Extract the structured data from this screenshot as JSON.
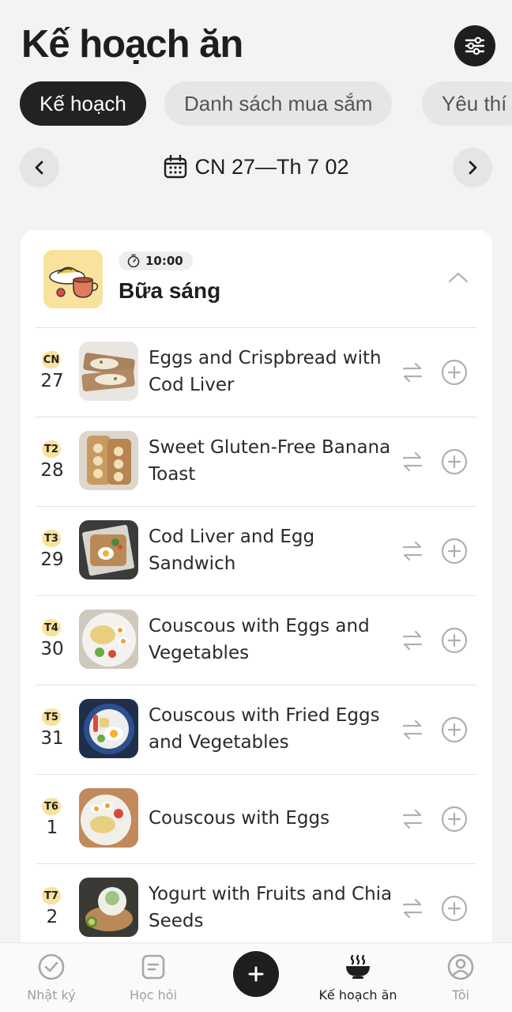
{
  "header": {
    "title": "Kế hoạch ăn",
    "settings_icon": "sliders-icon"
  },
  "tabs": [
    {
      "label": "Kế hoạch",
      "active": true
    },
    {
      "label": "Danh sách mua sắm",
      "active": false
    },
    {
      "label": "Yêu thí",
      "active": false
    }
  ],
  "week_nav": {
    "label": "CN 27—Th 7 02",
    "prev_icon": "chevron-left-icon",
    "next_icon": "chevron-right-icon",
    "calendar_icon": "calendar-icon"
  },
  "meal": {
    "time": "10:00",
    "name": "Bữa sáng",
    "items": [
      {
        "day": "CN",
        "date": "27",
        "name": "Eggs and Crispbread with Cod Liver"
      },
      {
        "day": "T2",
        "date": "28",
        "name": "Sweet Gluten-Free Banana Toast"
      },
      {
        "day": "T3",
        "date": "29",
        "name": "Cod Liver and Egg Sandwich"
      },
      {
        "day": "T4",
        "date": "30",
        "name": "Couscous with Eggs and Vegetables"
      },
      {
        "day": "T5",
        "date": "31",
        "name": "Couscous with Fried Eggs and Vegetables"
      },
      {
        "day": "T6",
        "date": "1",
        "name": "Couscous with Eggs"
      },
      {
        "day": "T7",
        "date": "2",
        "name": "Yogurt with Fruits and Chia Seeds"
      }
    ]
  },
  "bottom_nav": {
    "items": [
      {
        "label": "Nhật ký",
        "icon": "check-circle-icon",
        "active": false
      },
      {
        "label": "Học hỏi",
        "icon": "note-icon",
        "active": false
      },
      {
        "label": "Kế hoạch ăn",
        "icon": "bowl-icon",
        "active": true
      },
      {
        "label": "Tôi",
        "icon": "profile-icon",
        "active": false
      }
    ],
    "add_icon": "plus-icon"
  },
  "colors": {
    "accent": "#1e1e1e",
    "badge": "#f8e29c",
    "background": "#f3f3f3"
  }
}
